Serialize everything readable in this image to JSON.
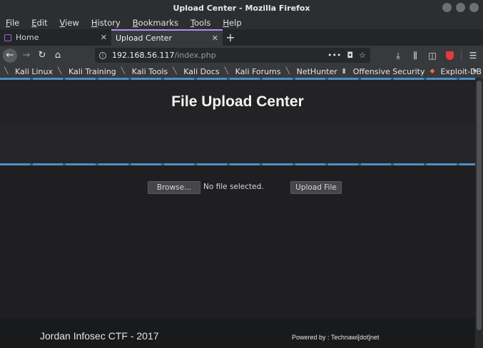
{
  "window": {
    "title": "Upload Center - Mozilla Firefox"
  },
  "menu": [
    "File",
    "Edit",
    "View",
    "History",
    "Bookmarks",
    "Tools",
    "Help"
  ],
  "tabs": [
    {
      "label": "Home",
      "active": false
    },
    {
      "label": "Upload Center",
      "active": true
    }
  ],
  "newtab_label": "+",
  "toolbar": {
    "url_host": "192.168.56.117",
    "url_path": "/index.php",
    "page_actions": "•••"
  },
  "bookmarks": [
    {
      "label": "Kali Linux",
      "icon": "kali-dragon-icon"
    },
    {
      "label": "Kali Training",
      "icon": "kali-dragon-icon"
    },
    {
      "label": "Kali Tools",
      "icon": "kali-dragon-icon"
    },
    {
      "label": "Kali Docs",
      "icon": "kali-dragon-icon"
    },
    {
      "label": "Kali Forums",
      "icon": "kali-dragon-icon"
    },
    {
      "label": "NetHunter",
      "icon": "kali-dragon-icon"
    },
    {
      "label": "Offensive Security",
      "icon": "offsec-icon"
    },
    {
      "label": "Exploit-DB",
      "icon": "exploitdb-icon"
    }
  ],
  "page": {
    "heading": "File Upload Center",
    "browse_label": "Browse...",
    "file_status": "No file selected.",
    "upload_label": "Upload File",
    "footer_left": "Jordan Infosec CTF - 2017",
    "footer_right": "Powered by : Technawi[dot]net"
  },
  "colors": {
    "accent_tab": "#b08ef7",
    "stripe": "#4d8fc2",
    "shield": "#e23c3c"
  }
}
